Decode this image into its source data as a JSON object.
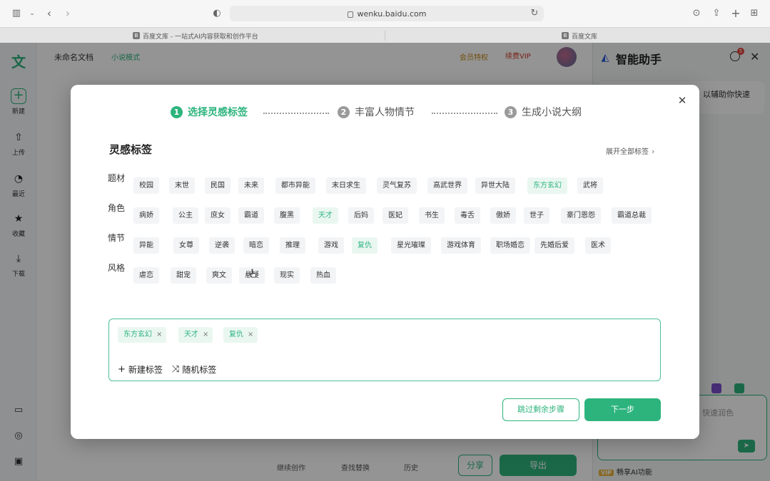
{
  "browser": {
    "url": "wenku.baidu.com",
    "tabs": [
      {
        "favicon": "B",
        "title": "百度文库 - 一站式AI内容获取和创作平台"
      },
      {
        "favicon": "B",
        "title": "百度文库"
      }
    ]
  },
  "app": {
    "logo": "文",
    "rail": {
      "new": "新建",
      "upload": "上传",
      "recent": "最近",
      "favorites": "收藏",
      "download": "下载"
    },
    "doc_title": "未命名文档",
    "doc_mode": "小说模式",
    "vip_link": "会员特权",
    "vip_button": "续费VIP",
    "bottom": {
      "item1": "继续创作",
      "item2": "查找替换",
      "item3": "历史",
      "share": "分享",
      "export": "导出"
    }
  },
  "assistant": {
    "title": "智能助手",
    "badge": "5",
    "bubble": "以辅助你快速",
    "input_placeholder": "快速润色",
    "vip_text": "畅享AI功能",
    "vip_tag": "VIP"
  },
  "modal": {
    "steps": [
      {
        "num": "1",
        "label": "选择灵感标签",
        "active": true
      },
      {
        "num": "2",
        "label": "丰富人物情节",
        "active": false
      },
      {
        "num": "3",
        "label": "生成小说大纲",
        "active": false
      }
    ],
    "section_title": "灵感标签",
    "expand_all": "展开全部标签",
    "rows": [
      {
        "label": "题材",
        "tags": [
          "校园",
          "末世",
          "民国",
          "未来",
          "都市异能",
          "末日求生",
          "灵气复苏",
          "高武世界",
          "异世大陆",
          "东方玄幻",
          "武将"
        ],
        "selected": [
          9
        ]
      },
      {
        "label": "角色",
        "tags": [
          "病娇",
          "公主",
          "庶女",
          "霸道",
          "腹黑",
          "天才",
          "后妈",
          "医妃",
          "书生",
          "毒舌",
          "傲娇",
          "世子",
          "豪门恩怨",
          "霸道总裁"
        ],
        "selected": [
          5
        ]
      },
      {
        "label": "情节",
        "tags": [
          "异能",
          "女尊",
          "逆袭",
          "暗恋",
          "推理",
          "游戏",
          "复仇",
          "星光璀璨",
          "游戏体育",
          "职场婚恋",
          "先婚后爱",
          "医术"
        ],
        "selected": [
          6
        ]
      },
      {
        "label": "风格",
        "tags": [
          "虐恋",
          "甜宠",
          "爽文",
          "悬疑",
          "现实",
          "热血"
        ],
        "selected": []
      }
    ],
    "selected_tags": [
      "东方玄幻",
      "天才",
      "复仇"
    ],
    "new_tag": "新建标签",
    "random_tag": "随机标签",
    "skip_button": "跳过剩余步骤",
    "next_button": "下一步",
    "colors": {
      "accent": "#2db47d",
      "chip_bg": "#f3f4f6",
      "chip_sel_bg": "#eaf7f1"
    }
  }
}
